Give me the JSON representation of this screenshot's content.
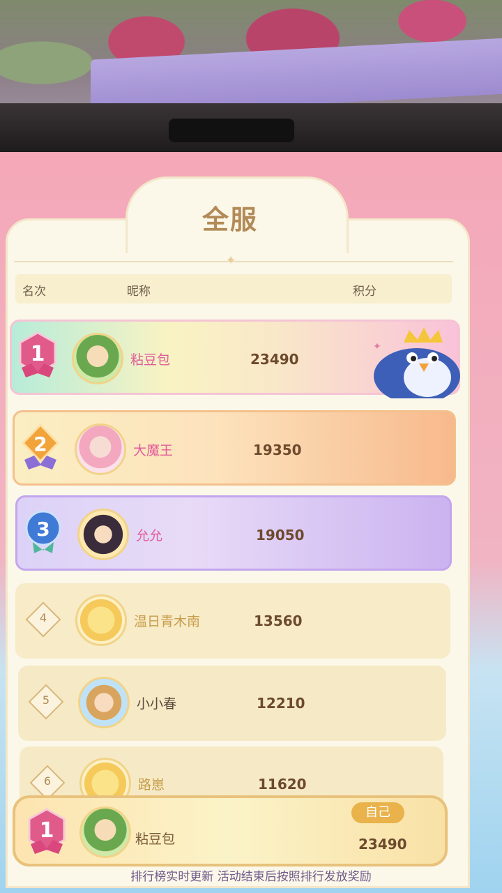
{
  "panel": {
    "title": "全服"
  },
  "header": {
    "rank": "名次",
    "nickname": "昵称",
    "score": "积分"
  },
  "rows": [
    {
      "rank": "1",
      "name": "粘豆包",
      "score": "23490"
    },
    {
      "rank": "2",
      "name": "大魔王",
      "score": "19350"
    },
    {
      "rank": "3",
      "name": "允允",
      "score": "19050"
    },
    {
      "rank": "4",
      "name": "温日青木南",
      "score": "13560"
    },
    {
      "rank": "5",
      "name": "小小春",
      "score": "12210"
    },
    {
      "rank": "6",
      "name": "路崽",
      "score": "11620"
    }
  ],
  "self": {
    "tag": "自己",
    "rank": "1",
    "name": "粘豆包",
    "score": "23490"
  },
  "footer": {
    "note": "排行榜实时更新 活动结束后按照排行发放奖励"
  },
  "colors": {
    "rank1_medal": "#e05a8a",
    "rank2_medal": "#f2a43a",
    "rank3_medal": "#3f7bd6",
    "accent_gold": "#b38a57"
  }
}
